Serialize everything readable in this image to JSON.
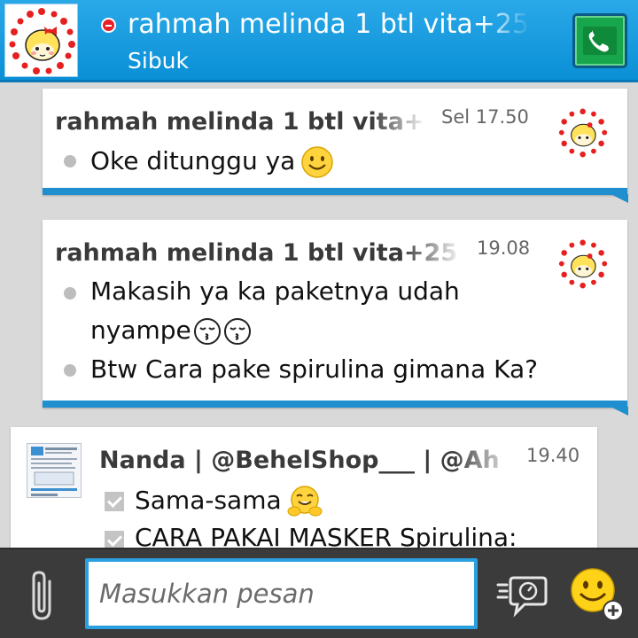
{
  "header": {
    "contact_name": "rahmah melinda 1 btl vita+25s",
    "status": "Sibuk",
    "status_icon": "busy-icon",
    "call_icon": "phone-icon"
  },
  "messages": [
    {
      "sender": "rahmah melinda 1 btl vita+",
      "time": "Sel 17.50",
      "lines": [
        "Oke ditunggu ya"
      ],
      "emoji": [
        "smiley"
      ]
    },
    {
      "sender": "rahmah melinda 1 btl vita+25",
      "time": "19.08",
      "lines": [
        "Makasih ya ka paketnya udah",
        "nyampe",
        "Btw Cara pake spirulina gimana Ka?"
      ],
      "emoji": [
        "kissing",
        "kissing"
      ]
    },
    {
      "sender": "Nanda | @BehelShop___ | @Ah",
      "time": "19.40",
      "lines": [
        "Sama-sama",
        "CARA PAKAI MASKER Spirulina:"
      ],
      "emoji": [
        "hugging"
      ]
    }
  ],
  "composer": {
    "placeholder": "Masukkan pesan",
    "attach_icon": "paperclip-icon",
    "ping_icon": "ping-icon",
    "emoticon_icon": "emoticon-add-icon"
  },
  "colors": {
    "header": "#0a8fd6",
    "accent": "#1f8fcf",
    "busy": "#e8202a",
    "call": "#17a64b"
  }
}
